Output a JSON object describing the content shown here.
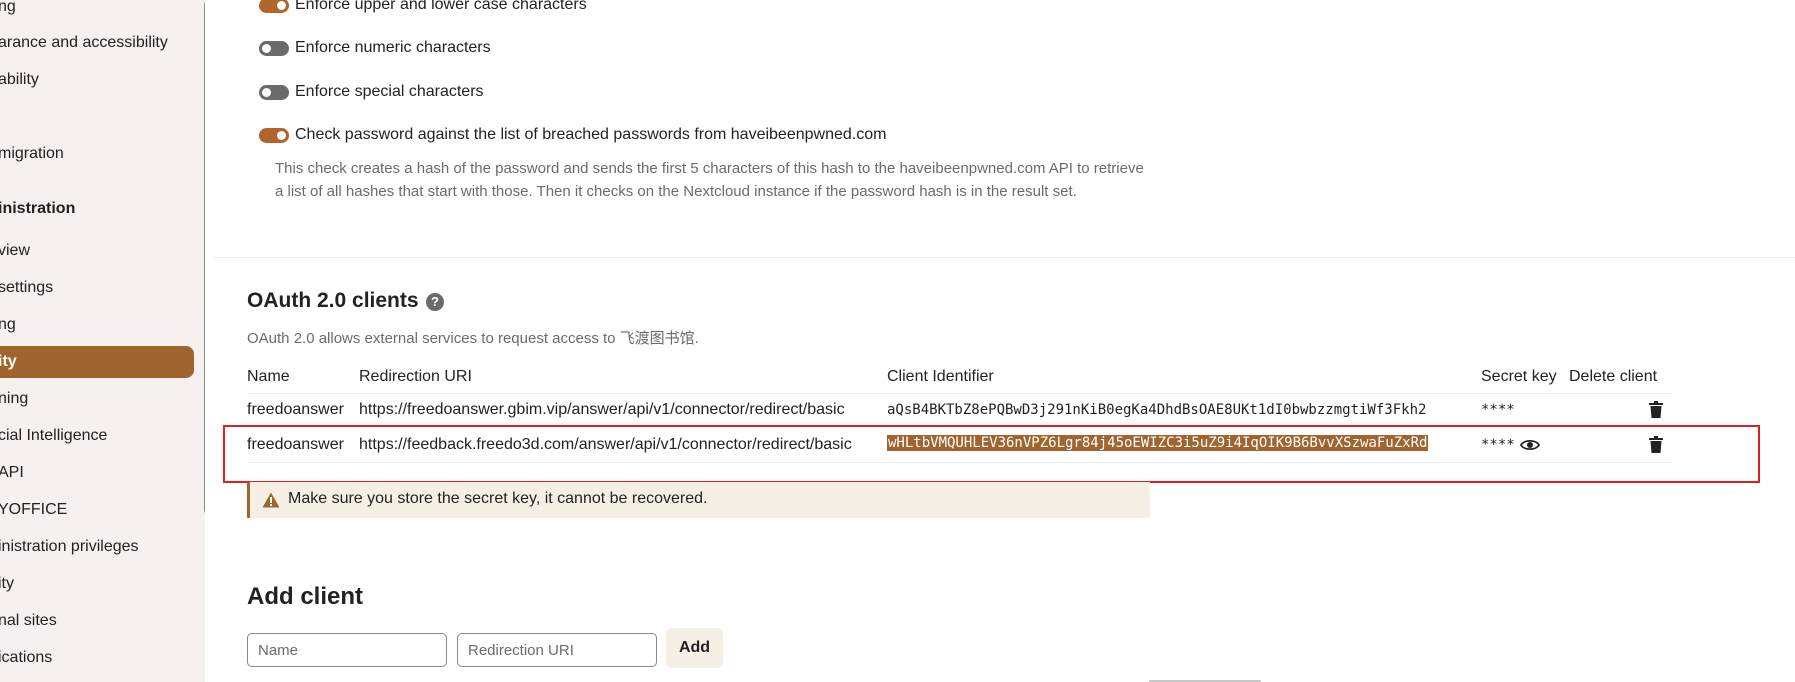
{
  "sidebar": {
    "items": [
      {
        "label": "ng"
      },
      {
        "label": "arance and accessibility"
      },
      {
        "label": "ability"
      },
      {
        "label": "migration"
      },
      {
        "label": "inistration"
      },
      {
        "label": "view"
      },
      {
        "label": " settings"
      },
      {
        "label": "ng"
      },
      {
        "label": "ity"
      },
      {
        "label": "ning"
      },
      {
        "label": "cial Intelligence"
      },
      {
        "label": "API"
      },
      {
        "label": "YOFFICE"
      },
      {
        "label": "inistration privileges"
      },
      {
        "label": "ity"
      },
      {
        "label": "nal sites"
      },
      {
        "label": "ications"
      }
    ]
  },
  "password_policy": {
    "options": [
      {
        "label": "Enforce upper and lower case characters",
        "enabled": true
      },
      {
        "label": "Enforce numeric characters",
        "enabled": false
      },
      {
        "label": "Enforce special characters",
        "enabled": false
      },
      {
        "label": "Check password against the list of breached passwords from haveibeenpwned.com",
        "enabled": true
      }
    ],
    "breach_hint": "This check creates a hash of the password and sends the first 5 characters of this hash to the haveibeenpwned.com API to retrieve a list of all hashes that start with those. Then it checks on the Nextcloud instance if the password hash is in the result set."
  },
  "oauth": {
    "title": "OAuth 2.0 clients",
    "help_icon": "?",
    "description": "OAuth 2.0 allows external services to request access to 飞渡图书馆.",
    "columns": {
      "name": "Name",
      "redirect": "Redirection URI",
      "client_id": "Client Identifier",
      "secret": "Secret key",
      "delete": "Delete client"
    },
    "clients": [
      {
        "name": "freedoanswer",
        "redirect": "https://freedoanswer.gbim.vip/answer/api/v1/connector/redirect/basic",
        "client_id": "aQsB4BKTbZ8ePQBwD3j291nKiB0egKa4DhdBsOAE8UKt1dI0bwbzzmgtiWf3Fkh2",
        "secret": "****"
      },
      {
        "name": "freedoanswer",
        "redirect": "https://feedback.freedo3d.com/answer/api/v1/connector/redirect/basic",
        "client_id": "wHLtbVMQUHLEV36nVPZ6Lgr84j45oEWIZC3i5uZ9i4IqOIK9B6BvvXSzwaFuZxRd",
        "secret": "****"
      }
    ],
    "warning": "Make sure you store the secret key, it cannot be recovered."
  },
  "add_client": {
    "title": "Add client",
    "name_placeholder": "Name",
    "redirect_placeholder": "Redirection URI",
    "add_label": "Add"
  },
  "colors": {
    "accent": "#a0652e",
    "toggle_on": "#b0652d",
    "highlight": "#e02020"
  }
}
